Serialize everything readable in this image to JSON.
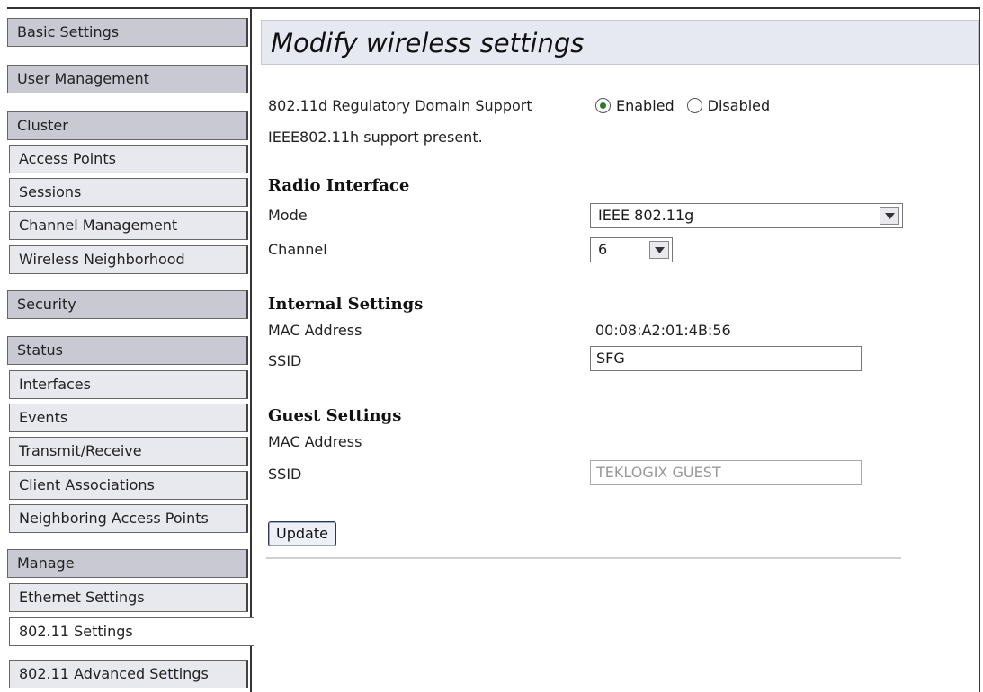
{
  "sidebar": {
    "basic_settings": "Basic Settings",
    "user_management": "User Management",
    "cluster": "Cluster",
    "access_points": "Access Points",
    "sessions": "Sessions",
    "channel_management": "Channel Management",
    "wireless_neighborhood": "Wireless Neighborhood",
    "security": "Security",
    "status": "Status",
    "interfaces": "Interfaces",
    "events": "Events",
    "transmit_receive": "Transmit/Receive",
    "client_associations": "Client Associations",
    "neighboring_access_points": "Neighboring Access Points",
    "manage": "Manage",
    "ethernet_settings": "Ethernet Settings",
    "settings_80211": "802.11 Settings",
    "advanced_settings_80211": "802.11 Advanced Settings"
  },
  "main": {
    "title": "Modify wireless settings",
    "regulatory_label": "802.11d Regulatory Domain Support",
    "regulatory_enabled": "Enabled",
    "regulatory_disabled": "Disabled",
    "regulatory_selected": "Enabled",
    "ieee_note": "IEEE802.11h support present.",
    "radio_interface": {
      "heading": "Radio Interface",
      "mode_label": "Mode",
      "mode_value": "IEEE 802.11g",
      "channel_label": "Channel",
      "channel_value": "6"
    },
    "internal_settings": {
      "heading": "Internal Settings",
      "mac_label": "MAC Address",
      "mac_value": "00:08:A2:01:4B:56",
      "ssid_label": "SSID",
      "ssid_value": "SFG"
    },
    "guest_settings": {
      "heading": "Guest Settings",
      "mac_label": "MAC Address",
      "ssid_label": "SSID",
      "ssid_value": "TEKLOGIX GUEST"
    },
    "update_button": "Update"
  },
  "colors": {
    "nav_header_bg": "#c9c9d4",
    "nav_sub_bg": "#e8e8ef",
    "title_bar_bg": "#e6e8f2",
    "radio_dot": "#2a7a2a"
  }
}
